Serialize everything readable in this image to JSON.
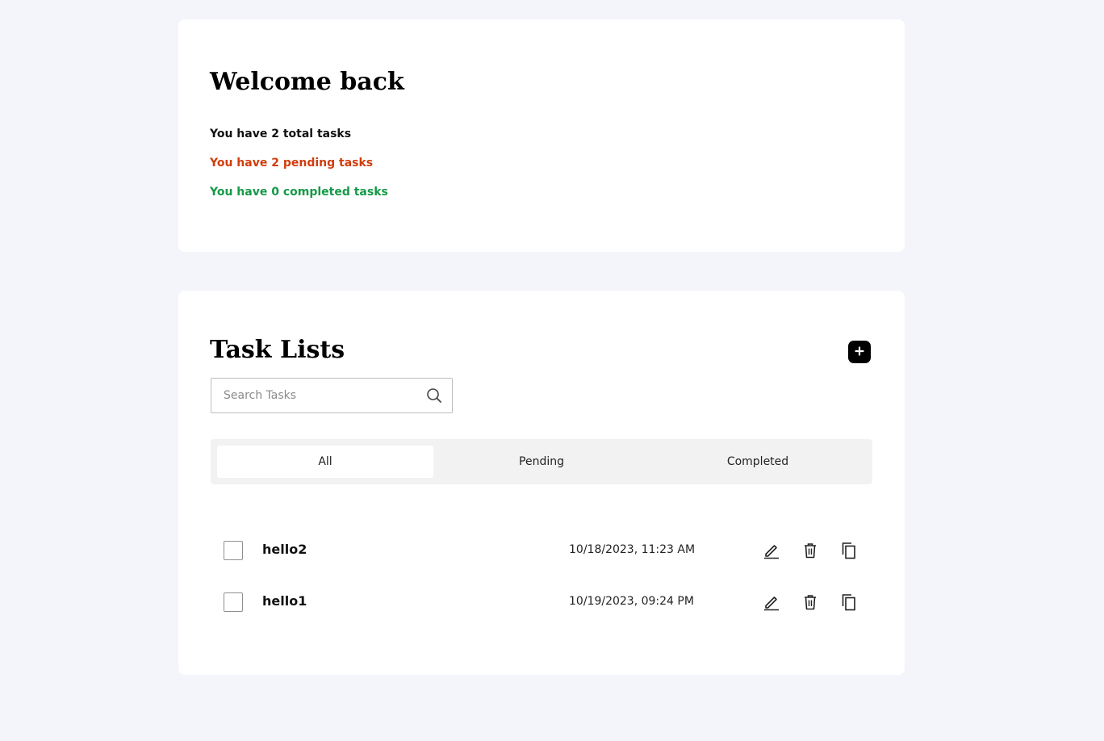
{
  "welcome": {
    "title": "Welcome back",
    "total_text": "You have 2 total tasks",
    "pending_text": "You have 2 pending tasks",
    "completed_text": "You have 0 completed tasks"
  },
  "tasks": {
    "title": "Task Lists",
    "add_icon": "plus-icon",
    "search": {
      "placeholder": "Search Tasks",
      "value": ""
    },
    "tabs": [
      {
        "label": "All",
        "active": true
      },
      {
        "label": "Pending",
        "active": false
      },
      {
        "label": "Completed",
        "active": false
      }
    ],
    "items": [
      {
        "name": "hello2",
        "date": "10/18/2023, 11:23 AM",
        "checked": false
      },
      {
        "name": "hello1",
        "date": "10/19/2023, 09:24 PM",
        "checked": false
      }
    ]
  },
  "colors": {
    "background": "#f4f4fb",
    "pending": "#d23c0c",
    "completed": "#159947"
  }
}
